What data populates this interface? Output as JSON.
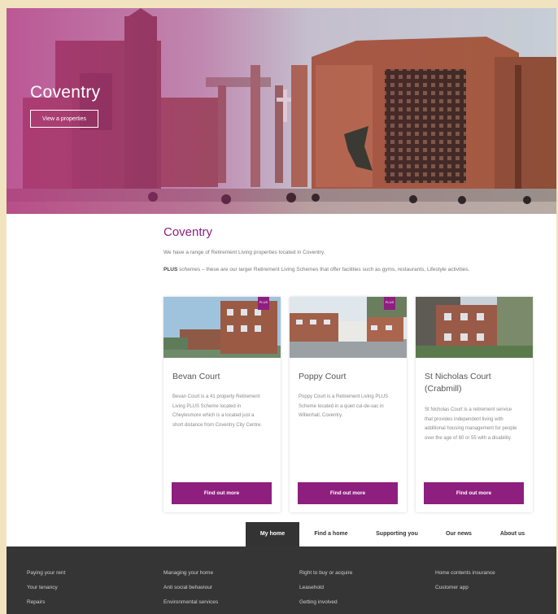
{
  "hero": {
    "title": "Coventry",
    "button_label": "View a properties"
  },
  "main": {
    "title": "Coventry",
    "intro": "We have a range of Retirement Living properties located in Coventry.",
    "plus_label": "PLUS",
    "plus_text": " schemes – these are our larger Retirement Living Schemes that offer facilities such as gyms, restaurants, Lifestyle activities."
  },
  "cards": [
    {
      "title": "Bevan Court",
      "badge": "PLUS",
      "description": "Bevan Court is a 41 property Retirement Living PLUS Scheme located in Cheylesmore which is a located just a short distance from Coventry City Centre.",
      "button_label": "Find out more"
    },
    {
      "title": "Poppy Court",
      "badge": "PLUS",
      "description": "Poppy Court is a Retirement Living PLUS Scheme located in a quiet cul-de-sac in Willenhall, Coventry.",
      "button_label": "Find out more"
    },
    {
      "title": "St Nicholas Court (Crabmill)",
      "description": "St Nicholas Court is a retirement service that provides independent living with additional housing management for people over the age of 60 or 55 with a disability.",
      "button_label": "Find out more"
    }
  ],
  "nav": {
    "items": [
      "My home",
      "Find a home",
      "Supporting you",
      "Our news",
      "About us"
    ],
    "active": "My home"
  },
  "footer": {
    "columns": [
      [
        "Paying your rent",
        "Your tenancy",
        "Repairs"
      ],
      [
        "Managing your home",
        "Anti social behaviour",
        "Environmental services"
      ],
      [
        "Right to buy or acquire",
        "Leasehold",
        "Getting involved"
      ],
      [
        "Home contents insurance",
        "Customer app"
      ]
    ]
  },
  "colors": {
    "brand_purple": "#8e1f7e",
    "footer_bg": "#353535",
    "page_border": "#f2e3c0"
  }
}
